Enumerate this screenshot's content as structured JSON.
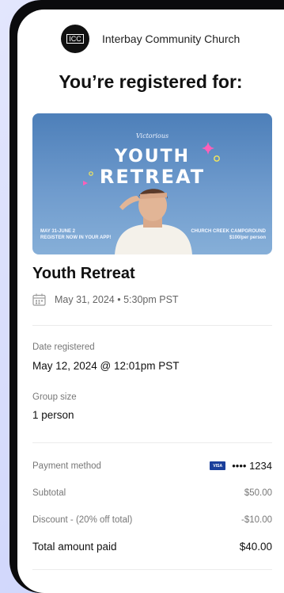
{
  "church": {
    "logo_text": "ICC",
    "name": "Interbay Community Church"
  },
  "headline": "You’re registered for:",
  "banner": {
    "tagline": "Victorious",
    "title_line1": "YOUTH",
    "title_line2": "RETREAT",
    "left_text_line1": "MAY 31-JUNE 2",
    "left_text_line2": "REGISTER NOW IN YOUR APP!",
    "right_text_line1": "CHURCH CREEK CAMPGROUND",
    "right_text_line2": "$100/per person"
  },
  "event": {
    "title": "Youth Retreat",
    "date": "May 31, 2024 • 5:30pm PST"
  },
  "details": {
    "date_registered_label": "Date registered",
    "date_registered_value": "May 12, 2024 @ 12:01pm PST",
    "group_size_label": "Group size",
    "group_size_value": "1 person"
  },
  "payment": {
    "method_label": "Payment method",
    "card_brand": "VISA",
    "card_masked": "•••• 1234",
    "subtotal_label": "Subtotal",
    "subtotal_value": "$50.00",
    "discount_label": "Discount - (20% off total)",
    "discount_value": "-$10.00",
    "total_label": "Total amount paid",
    "total_value": "$40.00"
  },
  "colors": {
    "background": "#d6dcfa",
    "phone_frame": "#0b0b0d",
    "banner_sky": "#6f9bcd",
    "visa_blue": "#1a3f9b"
  }
}
